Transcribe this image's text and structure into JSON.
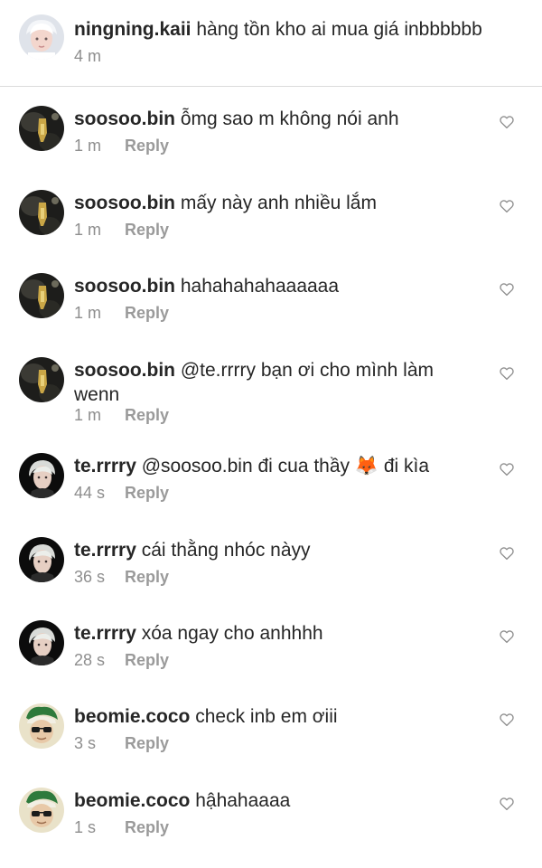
{
  "caption": {
    "username": "ningning.kaii",
    "text": "hàng tồn kho ai mua giá inbbbbbb",
    "time": "4 m"
  },
  "reply_label": "Reply",
  "comments": [
    {
      "username": "soosoo.bin",
      "text": "ỗmg sao m không nói anh",
      "time": "1 m",
      "avatar": "soosoo"
    },
    {
      "username": "soosoo.bin",
      "text": "mấy này anh nhiều lắm",
      "time": "1 m",
      "avatar": "soosoo"
    },
    {
      "username": "soosoo.bin",
      "text": "hahahahahaaaaaa",
      "time": "1 m",
      "avatar": "soosoo"
    },
    {
      "username": "soosoo.bin",
      "text": "@te.rrrry bạn ơi cho mình làm",
      "text_line2": "wenn",
      "time": "1 m",
      "avatar": "soosoo"
    },
    {
      "username": "te.rrrry",
      "text": "@soosoo.bin đi cua thầy 🦊 đi kìa",
      "time": "44 s",
      "avatar": "terrrry"
    },
    {
      "username": "te.rrrry",
      "text": "cái thằng nhóc nàyy",
      "time": "36 s",
      "avatar": "terrrry"
    },
    {
      "username": "te.rrrry",
      "text": "xóa ngay cho anhhhh",
      "time": "28 s",
      "avatar": "terrrry"
    },
    {
      "username": "beomie.coco",
      "text": "check inb em ơiii",
      "time": "3 s",
      "avatar": "beomie"
    },
    {
      "username": "beomie.coco",
      "text": "hậhahaaaa",
      "time": "1 s",
      "avatar": "beomie"
    }
  ],
  "icons": {
    "like": "heart-outline-icon"
  },
  "colors": {
    "text": "#262626",
    "muted": "#8e8e8e",
    "divider": "#dbdbdb"
  }
}
